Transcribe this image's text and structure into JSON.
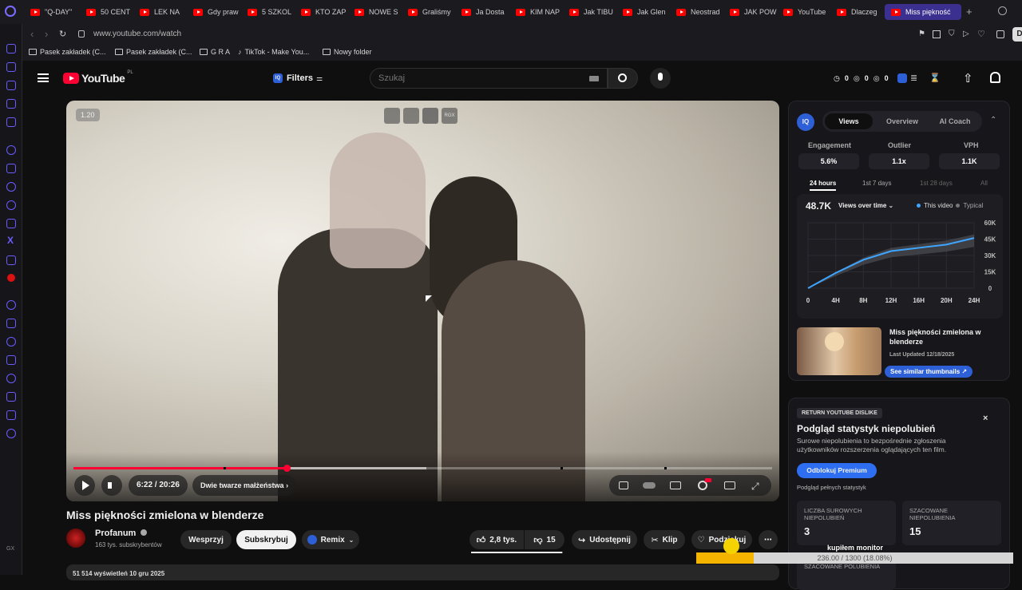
{
  "browser": {
    "tabs": [
      {
        "label": "\"Q-DAY\""
      },
      {
        "label": "50 CENT"
      },
      {
        "label": "LEK NA"
      },
      {
        "label": "Gdy praw"
      },
      {
        "label": "5 SZKOL"
      },
      {
        "label": "KTO ZAP"
      },
      {
        "label": "NOWE S"
      },
      {
        "label": "Graliśmy"
      },
      {
        "label": "Ja Dosta"
      },
      {
        "label": "KIM NAP"
      },
      {
        "label": "Jak TIBU"
      },
      {
        "label": "Jak Glen"
      },
      {
        "label": "Neostrad"
      },
      {
        "label": "JAK POW"
      },
      {
        "label": "YouTube"
      },
      {
        "label": "Dlaczeg"
      },
      {
        "label": "Miss piękność"
      }
    ],
    "url": "www.youtube.com/watch",
    "bookmarks": [
      "Pasek zakładek (C...",
      "Pasek zakładek (C...",
      "G R A",
      "TikTok - Make You...",
      "Nowy folder"
    ]
  },
  "header": {
    "logo_text": "YouTube",
    "country": "PL",
    "filters_label": "Filters",
    "search_placeholder": "Szukaj",
    "stats": [
      "0",
      "0",
      "0"
    ]
  },
  "player": {
    "speed_badge": "1.20",
    "time": "6:22 / 20:26",
    "chapter": "Dwie twarze małżeństwa",
    "progress": 0.305,
    "rgx_label": "RGX"
  },
  "video": {
    "title": "Miss piękności zmielona w blenderze",
    "channel": "Profanum",
    "subscribers": "163 tys. subskrybentów",
    "support_label": "Wesprzyj",
    "subscribe_label": "Subskrybuj",
    "remix_label": "Remix",
    "likes": "2,8 tys.",
    "dislikes": "15",
    "share_label": "Udostępnij",
    "clip_label": "Klip",
    "thanks_label": "Podziękuj",
    "views_line": "51 514 wyświetleń  10 gru 2025"
  },
  "iq_panel": {
    "tabs": [
      "Views",
      "Overview",
      "AI Coach"
    ],
    "metrics": [
      {
        "label": "Engagement",
        "value": "5.6%"
      },
      {
        "label": "Outlier",
        "value": "1.1x"
      },
      {
        "label": "VPH",
        "value": "1.1K"
      }
    ],
    "ranges": [
      "24 hours",
      "1st 7 days",
      "1st 28 days",
      "All"
    ],
    "views_total": "48.7K",
    "views_dropdown": "Views over time",
    "legend_this": "This video",
    "legend_typical": "Typical",
    "thumb_title": "Miss piękności zmielona w blenderze",
    "thumb_updated": "Last Updated 12/18/2025",
    "thumb_button": "See similar thumbnails"
  },
  "chart_data": {
    "type": "line",
    "x": [
      "0",
      "4H",
      "8H",
      "12H",
      "16H",
      "20H",
      "24H"
    ],
    "ylim": [
      0,
      60000
    ],
    "yticks": [
      "60K",
      "45K",
      "30K",
      "15K",
      "0"
    ],
    "series": [
      {
        "name": "This video",
        "values": [
          0,
          14000,
          26000,
          34000,
          37000,
          40000,
          46000
        ]
      },
      {
        "name": "Typical",
        "values": [
          0,
          13000,
          25000,
          33000,
          36000,
          39000,
          44000
        ]
      }
    ],
    "grid": true,
    "legend": "top-right"
  },
  "dislike_panel": {
    "badge": "RETURN YOUTUBE DISLIKE",
    "title": "Podgląd statystyk niepolubień",
    "desc": "Surowe niepolubienia to bezpośrednie zgłoszenia użytkowników rozszerzenia oglądających ten film.",
    "unlock_label": "Odblokuj Premium",
    "preview_label": "Podgląd pełnych statystyk",
    "raw_label": "LICZBA SUROWYCH NIEPOLUBIEŃ",
    "raw_value": "3",
    "est_label": "SZACOWANE NIEPOLUBIENIA",
    "est_value": "15",
    "est2_label": "SZACOWANE POLUBIENIA"
  },
  "overlay": {
    "monitor_label": "kupiłem monitor",
    "progress_text": "236.00 / 1300 (18.08%)",
    "progress": 0.1808
  },
  "colors": {
    "accent": "#3ea6ff",
    "red": "#ff0033",
    "brand_purple": "#3b2f8f"
  }
}
